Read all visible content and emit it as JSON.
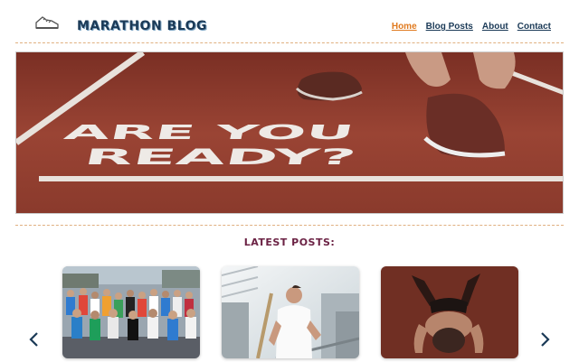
{
  "header": {
    "site_title": "MARATHON BLOG",
    "logo_icon": "running-shoe-icon",
    "nav": [
      {
        "label": "Home",
        "active": true
      },
      {
        "label": "Blog Posts",
        "active": false
      },
      {
        "label": "About",
        "active": false
      },
      {
        "label": "Contact",
        "active": false
      }
    ]
  },
  "hero": {
    "line1": "ARE YOU",
    "line2": "READY?"
  },
  "latest": {
    "title": "LATEST POSTS:"
  },
  "carousel": {
    "prev_icon": "chevron-left-icon",
    "next_icon": "chevron-right-icon"
  },
  "colors": {
    "brand": "#1b3a57",
    "accent": "#e07a1f",
    "section_title": "#6b2244",
    "track": "#8e3b2c"
  }
}
